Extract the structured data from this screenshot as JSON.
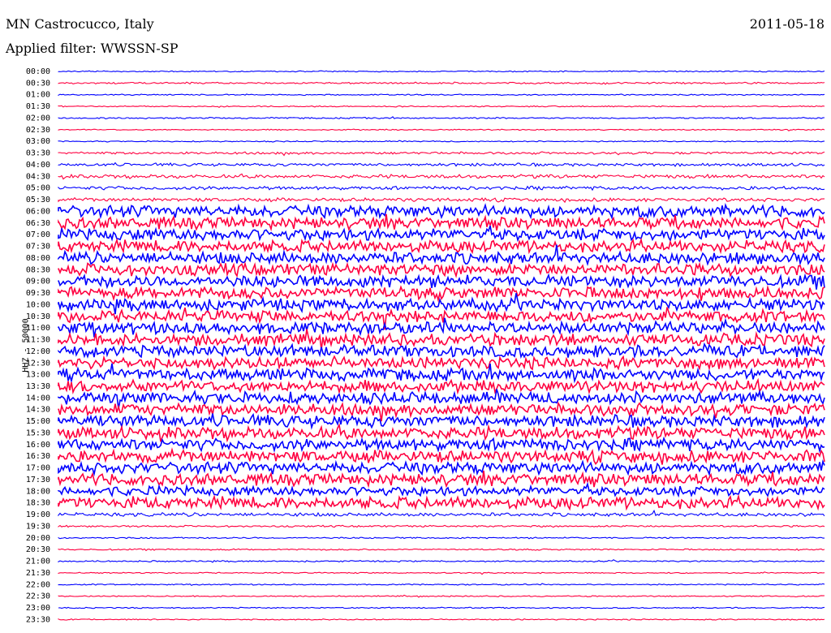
{
  "header": {
    "station": "MN Castrocucco, Italy",
    "filter": "Applied filter: WWSSN-SP",
    "date": "2011-05-18"
  },
  "chart_data": {
    "type": "line",
    "title": "MN Castrocucco, Italy",
    "subtitle": "Applied filter: WWSSN-SP",
    "ylabel": "HHZ - 50000",
    "categories": [
      "00:00",
      "00:30",
      "01:00",
      "01:30",
      "02:00",
      "02:30",
      "03:00",
      "03:30",
      "04:00",
      "04:30",
      "05:00",
      "05:30",
      "06:00",
      "06:30",
      "07:00",
      "07:30",
      "08:00",
      "08:30",
      "09:00",
      "09:30",
      "10:00",
      "10:30",
      "11:00",
      "11:30",
      "12:00",
      "12:30",
      "13:00",
      "13:30",
      "14:00",
      "14:30",
      "15:00",
      "15:30",
      "16:00",
      "16:30",
      "17:00",
      "17:30",
      "18:00",
      "18:30",
      "19:00",
      "19:30",
      "20:00",
      "20:30",
      "21:00",
      "21:30",
      "22:00",
      "22:30",
      "23:00",
      "23:30"
    ],
    "series_colors": [
      "#0000ff",
      "#ff0040"
    ],
    "trace_amplitude": [
      1,
      1.4,
      1,
      1,
      1.2,
      1,
      1,
      2,
      2.5,
      3,
      3,
      3,
      10,
      10,
      10,
      10,
      10,
      10,
      10,
      10,
      10,
      10,
      10,
      10,
      10,
      10,
      10,
      10,
      10,
      10,
      10,
      10,
      10,
      10,
      10,
      10,
      8,
      10,
      3,
      1.5,
      1.2,
      1.2,
      1.2,
      1,
      1,
      1,
      1,
      1
    ],
    "grid": false,
    "legend": "none"
  }
}
